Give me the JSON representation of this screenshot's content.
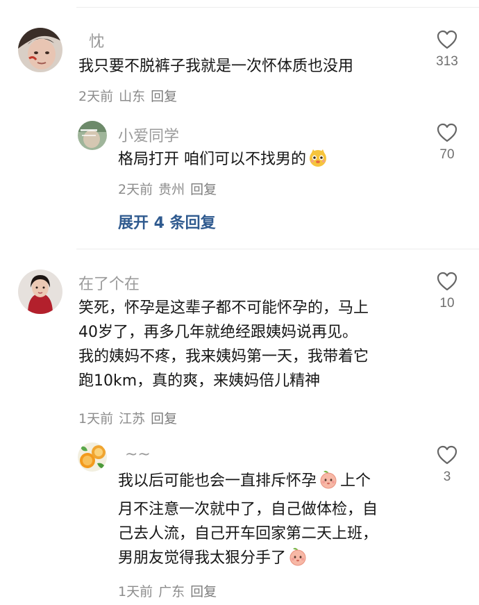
{
  "comments": [
    {
      "username": "忱",
      "text_lines": [
        "我只要不脱裤子我就是一次怀体质也没用"
      ],
      "time": "2天前",
      "location": "山东",
      "reply_label": "回复",
      "likes": "313",
      "avatar_icon": "portrait-avatar-man"
    },
    {
      "username": "小爱同学",
      "text_lines": [
        "格局打开 咱们可以不找男的"
      ],
      "time": "2天前",
      "location": "贵州",
      "reply_label": "回复",
      "likes": "70",
      "avatar_icon": "portrait-avatar-green",
      "emoji": "smirk-cat-emoji"
    },
    {
      "username": "在了个在",
      "text_lines": [
        "笑死，怀孕是这辈子都不可能怀孕的，马上",
        "40岁了，再多几年就绝经跟姨妈说再见。",
        "我的姨妈不疼，我来姨妈第一天，我带着它",
        "跑10km，真的爽，来姨妈倍儿精神"
      ],
      "time": "1天前",
      "location": "江苏",
      "reply_label": "回复",
      "likes": "10",
      "avatar_icon": "portrait-avatar-woman"
    },
    {
      "username": "~~",
      "text_lines": [
        "我以后可能也会一直排斥怀孕",
        "上个",
        "月不注意一次就中了，自己做体检，自",
        "己去人流，自己开车回家第二天上班，",
        "男朋友觉得我太狠分手了"
      ],
      "time": "1天前",
      "location": "广东",
      "reply_label": "回复",
      "likes": "3",
      "avatar_icon": "fruit-avatar-orange",
      "emoji": "peach-face-emoji"
    }
  ],
  "expand_replies": "展开 4 条回复",
  "colors": {
    "username": "#9a9a9a",
    "meta": "#8c8c8c",
    "link": "#2f5a8f",
    "text": "#161616"
  }
}
